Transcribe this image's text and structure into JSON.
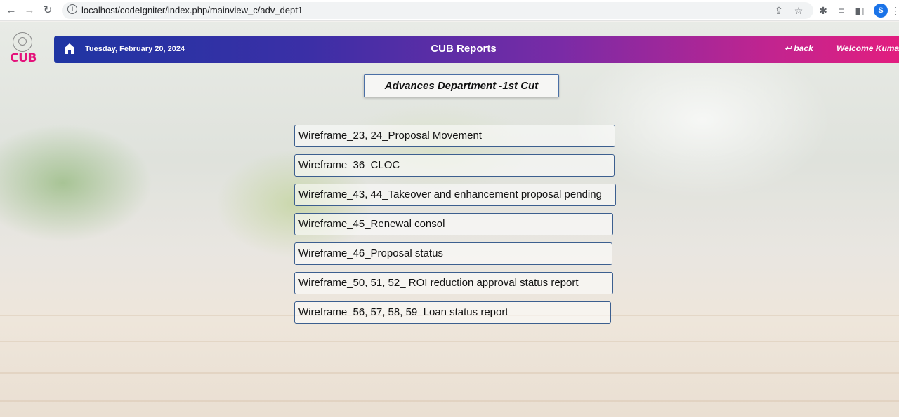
{
  "browser": {
    "url": "localhost/codeIgniter/index.php/mainview_c/adv_dept1",
    "profile_initial": "S",
    "icons": [
      "back-arrow-icon",
      "forward-arrow-icon",
      "reload-icon",
      "site-info-icon",
      "share-icon",
      "bookmark-star-icon",
      "extensions-icon",
      "media-icon",
      "sidebar-icon",
      "menu-icon"
    ]
  },
  "logo": {
    "text": "CUB",
    "color": "#e4127b"
  },
  "header": {
    "date": "Tuesday, February 20, 2024",
    "title": "CUB Reports",
    "back_label": "back",
    "welcome": "Welcome Kumar",
    "gradient_start": "#1f35a3",
    "gradient_end": "#e21e7f"
  },
  "department_title": "Advances Department -1st Cut",
  "reports": [
    {
      "label": "Wireframe_23, 24_Proposal Movement"
    },
    {
      "label": "Wireframe_36_CLOC"
    },
    {
      "label": "Wireframe_43, 44_Takeover and enhancement proposal pending"
    },
    {
      "label": "Wireframe_45_Renewal consol"
    },
    {
      "label": "Wireframe_46_Proposal status"
    },
    {
      "label": "Wireframe_50, 51, 52_ ROI reduction approval status report"
    },
    {
      "label": "Wireframe_56, 57, 58, 59_Loan status report"
    }
  ]
}
